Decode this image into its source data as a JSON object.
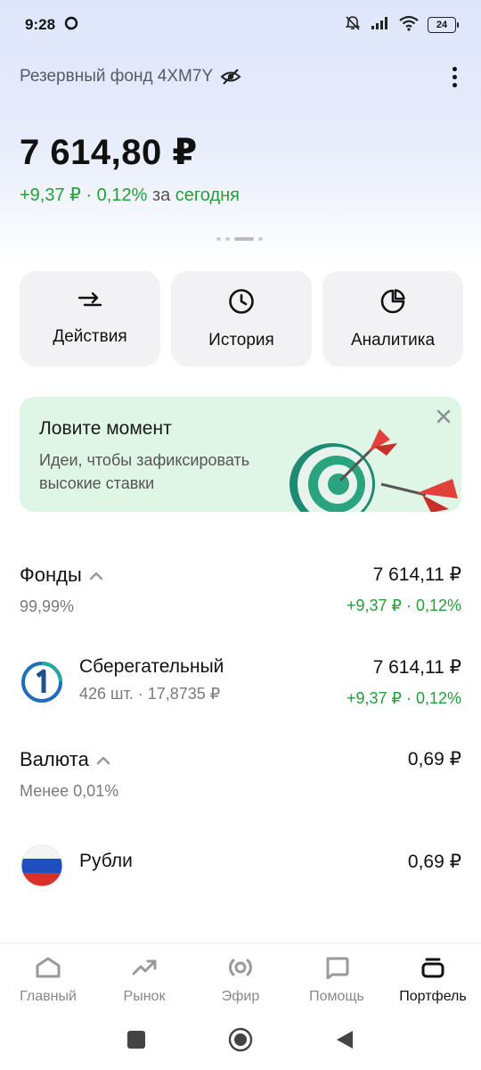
{
  "status_bar": {
    "time": "9:28",
    "battery": "24"
  },
  "header": {
    "account_name": "Резервный фонд 4XM7Y"
  },
  "balance": {
    "total": "7 614,80 ₽",
    "change_value": "+9,37 ₽ · 0,12%",
    "change_suffix_plain": "за",
    "change_suffix_period": "сегодня"
  },
  "actions": [
    {
      "label": "Действия",
      "icon": "arrows-exchange-icon"
    },
    {
      "label": "История",
      "icon": "clock-icon"
    },
    {
      "label": "Аналитика",
      "icon": "pie-chart-icon"
    }
  ],
  "promo": {
    "title": "Ловите момент",
    "text": "Идеи, чтобы зафиксировать высокие ставки"
  },
  "sections": {
    "funds": {
      "title": "Фонды",
      "share": "99,99%",
      "amount": "7 614,11 ₽",
      "change": "+9,37 ₽ · 0,12%"
    },
    "fund_item": {
      "name": "Сберегательный",
      "details": "426 шт. · 17,8735 ₽",
      "amount": "7 614,11 ₽",
      "change": "+9,37 ₽ · 0,12%"
    },
    "currency": {
      "title": "Валюта",
      "share": "Менее 0,01%",
      "amount": "0,69 ₽"
    },
    "currency_item": {
      "name": "Рубли",
      "amount": "0,69 ₽"
    }
  },
  "bottom_nav": [
    {
      "label": "Главный",
      "icon": "home-icon"
    },
    {
      "label": "Рынок",
      "icon": "trend-icon"
    },
    {
      "label": "Эфир",
      "icon": "broadcast-icon"
    },
    {
      "label": "Помощь",
      "icon": "chat-icon"
    },
    {
      "label": "Портфель",
      "icon": "briefcase-icon",
      "active": true
    }
  ],
  "colors": {
    "positive": "#21a038",
    "header_bg": "#dfe6fb",
    "promo_bg": "#dff5e5"
  }
}
